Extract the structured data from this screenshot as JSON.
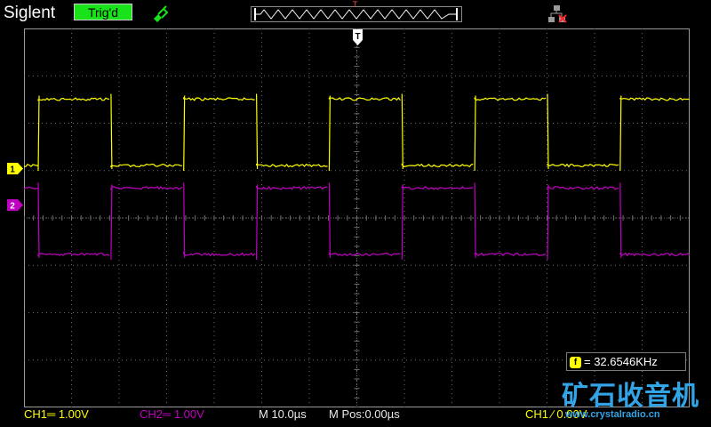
{
  "header": {
    "brand": "Siglent",
    "trigger_status": "Trig'd",
    "trigger_position_marker": "T"
  },
  "markers": {
    "trigger_level": "T",
    "ch1": "1",
    "ch2": "2"
  },
  "measurement": {
    "icon": "f",
    "text": "= 32.6546KHz"
  },
  "status_bar": {
    "ch1": "CH1═ 1.00V",
    "ch2": "CH2═ 1.00V",
    "timebase": "M 10.0µs",
    "position": "M Pos:0.00µs",
    "trigger": "CH1 ∕ 0.00V"
  },
  "watermark": {
    "cn": "矿石收音机",
    "url": "www.crystalradio.cn"
  },
  "colors": {
    "ch1": "#ffff00",
    "ch2": "#c000c0",
    "trig_indicator": "#18e21a",
    "grid": "#6e6e6e",
    "watermark": "#33a4e6"
  },
  "chart_data": {
    "type": "line",
    "title": "",
    "xlabel": "",
    "ylabel": "",
    "x_divisions": 14,
    "y_divisions": 8,
    "time_per_div_us": 10.0,
    "volts_per_div": 1.0,
    "frequency_khz": 32.6546,
    "period_us": 30.6,
    "duty_high": 0.5,
    "series": [
      {
        "name": "CH1",
        "color": "#ffff00",
        "high_div": 1.4,
        "low_div": 0.0,
        "phase_div": 0.0
      },
      {
        "name": "CH2",
        "color": "#c000c0",
        "high_div": 0.35,
        "low_div": -1.05,
        "phase_div": 1.53
      }
    ]
  }
}
